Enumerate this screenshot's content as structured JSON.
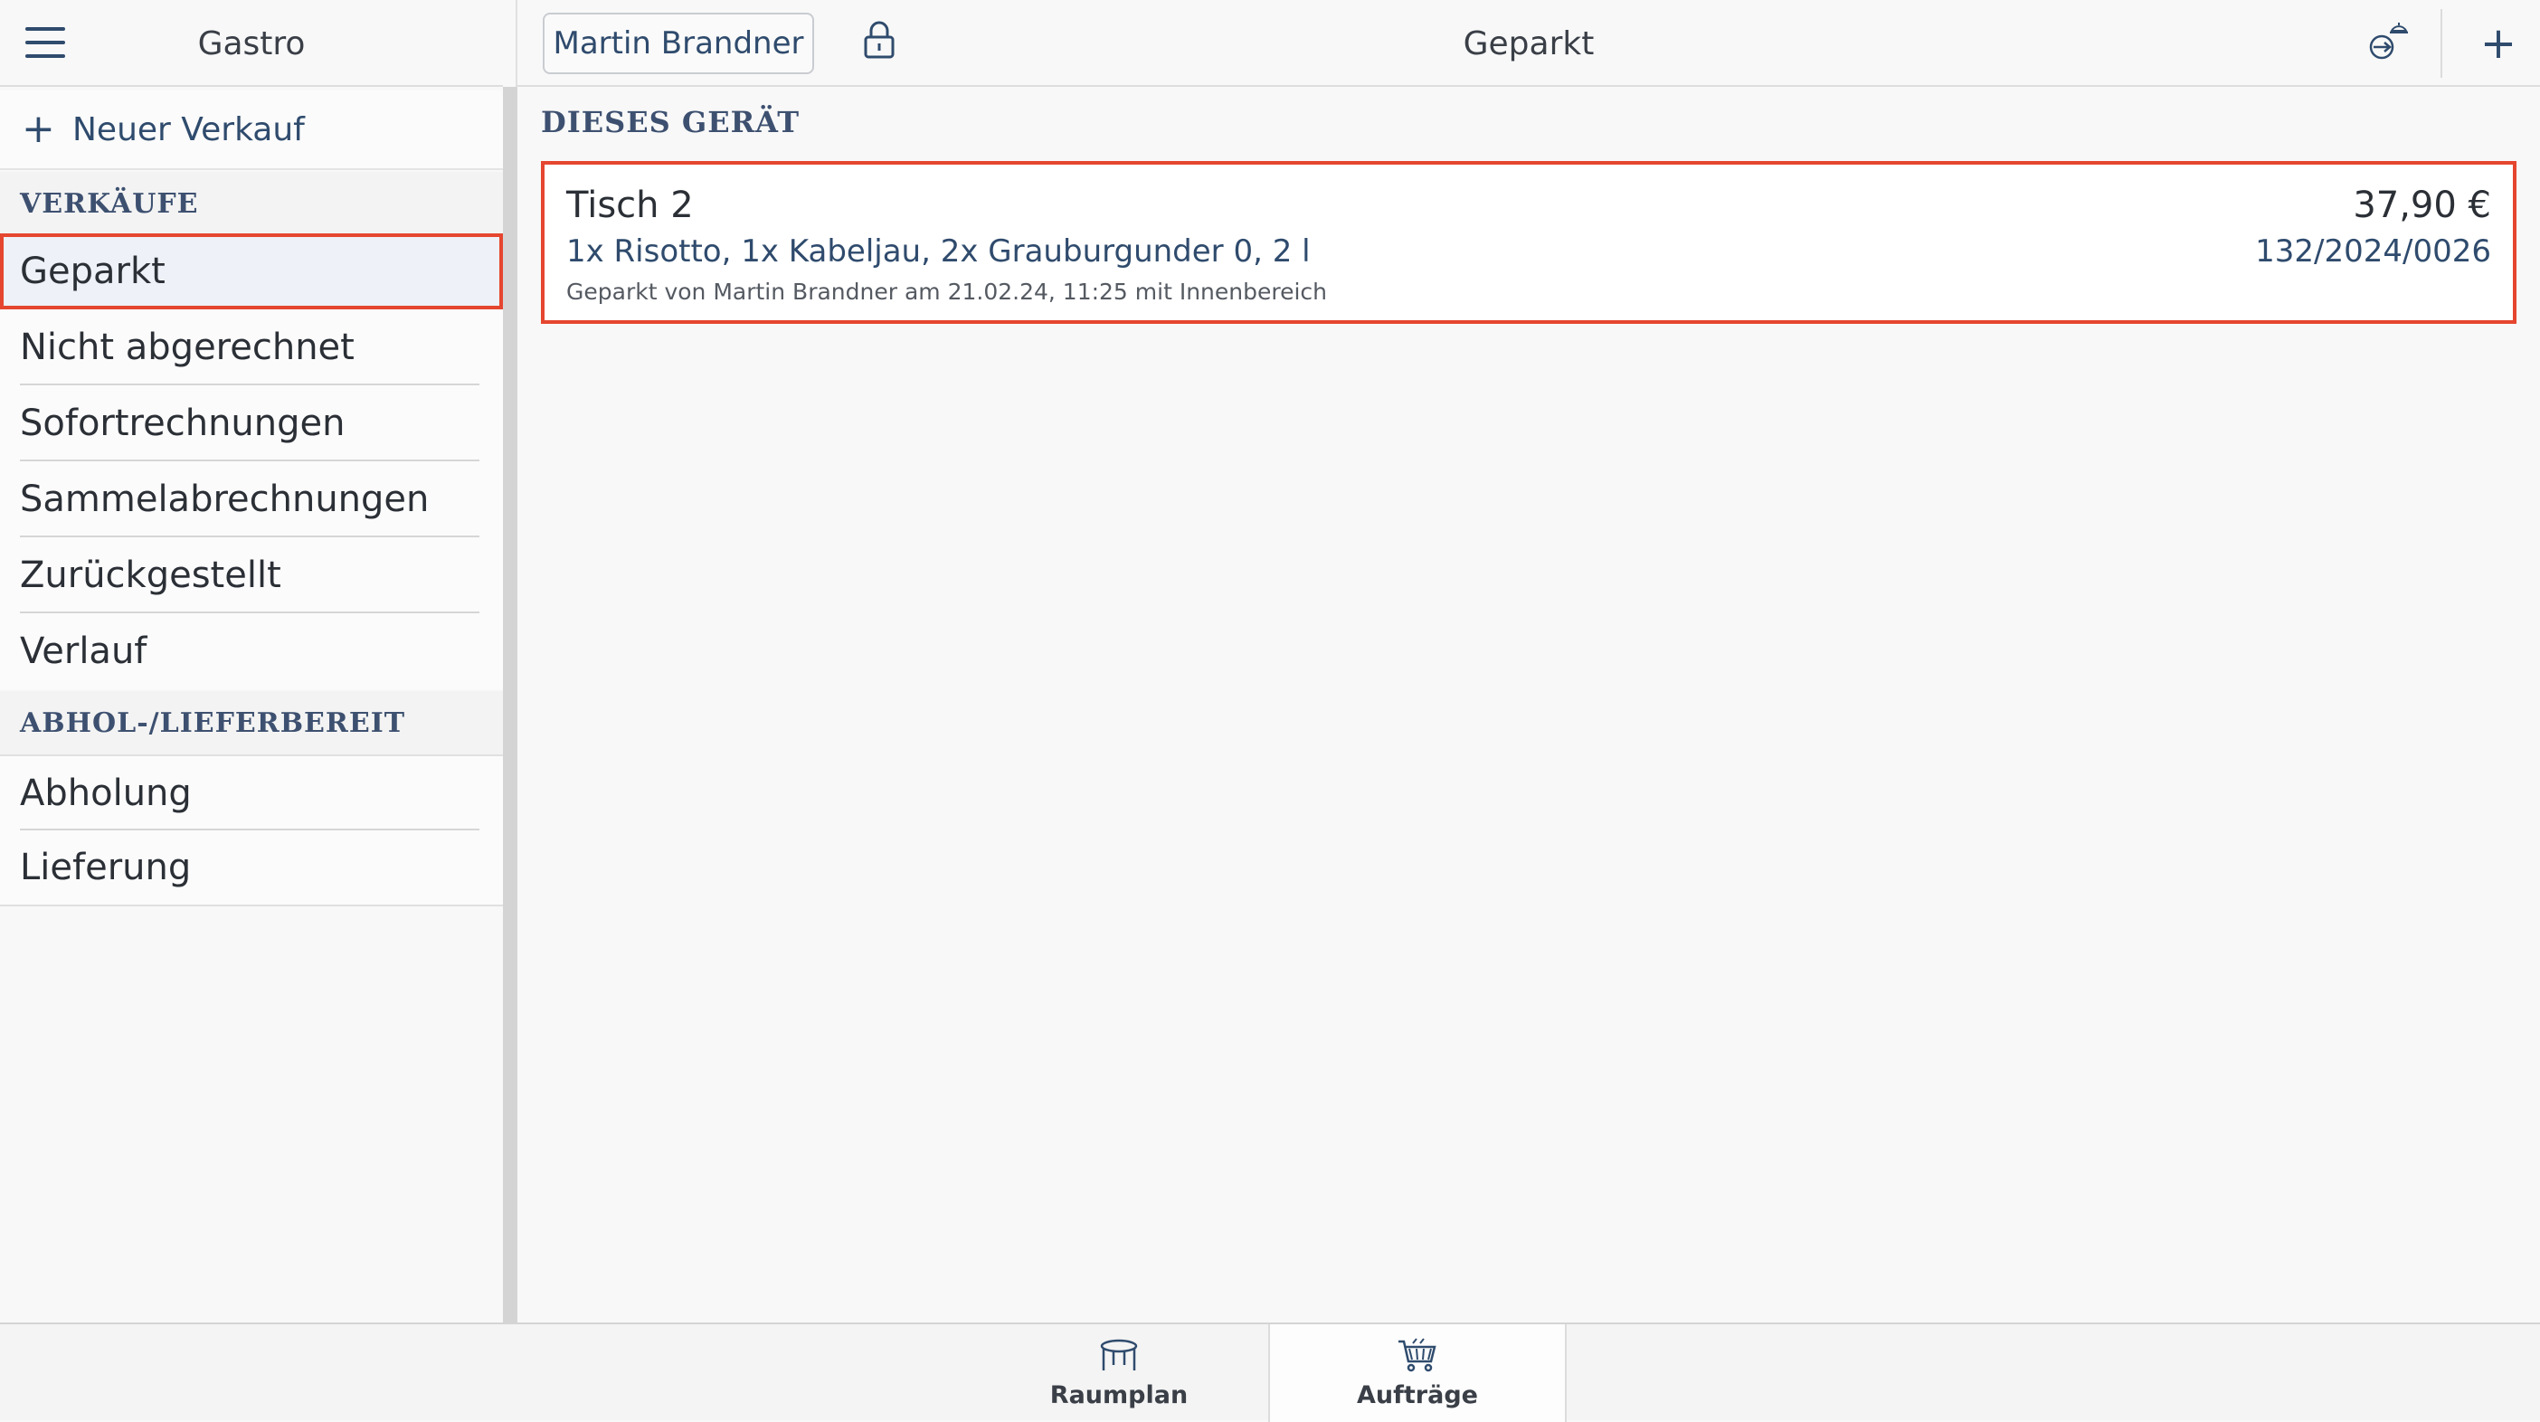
{
  "sidebar": {
    "title": "Gastro",
    "new_sale_label": "Neuer Verkauf",
    "section_sales": "VERKÄUFE",
    "items": [
      {
        "label": "Geparkt"
      },
      {
        "label": "Nicht abgerechnet"
      },
      {
        "label": "Sofortrechnungen"
      },
      {
        "label": "Sammelabrechnungen"
      },
      {
        "label": "Zurückgestellt"
      },
      {
        "label": "Verlauf"
      }
    ],
    "section_pickup": "ABHOL-/LIEFERBEREIT",
    "pickup_items": [
      {
        "label": "Abholung"
      },
      {
        "label": "Lieferung"
      }
    ]
  },
  "topbar": {
    "user_label": "Martin Brandner",
    "title": "Geparkt",
    "add_label": "+"
  },
  "main": {
    "section_label": "DIESES GERÄT",
    "orders": [
      {
        "title": "Tisch 2",
        "items": "1x Risotto, 1x Kabeljau, 2x Grauburgunder 0, 2 l",
        "meta": "Geparkt von Martin Brandner am 21.02.24, 11:25 mit Innenbereich",
        "price": "37,90 €",
        "number": "132/2024/0026"
      }
    ]
  },
  "bottom_tabs": [
    {
      "label": "Raumplan",
      "icon": "table-icon"
    },
    {
      "label": "Aufträge",
      "icon": "basket-icon"
    }
  ],
  "colors": {
    "accent": "#2f4b6d",
    "highlight": "#e5462f"
  }
}
